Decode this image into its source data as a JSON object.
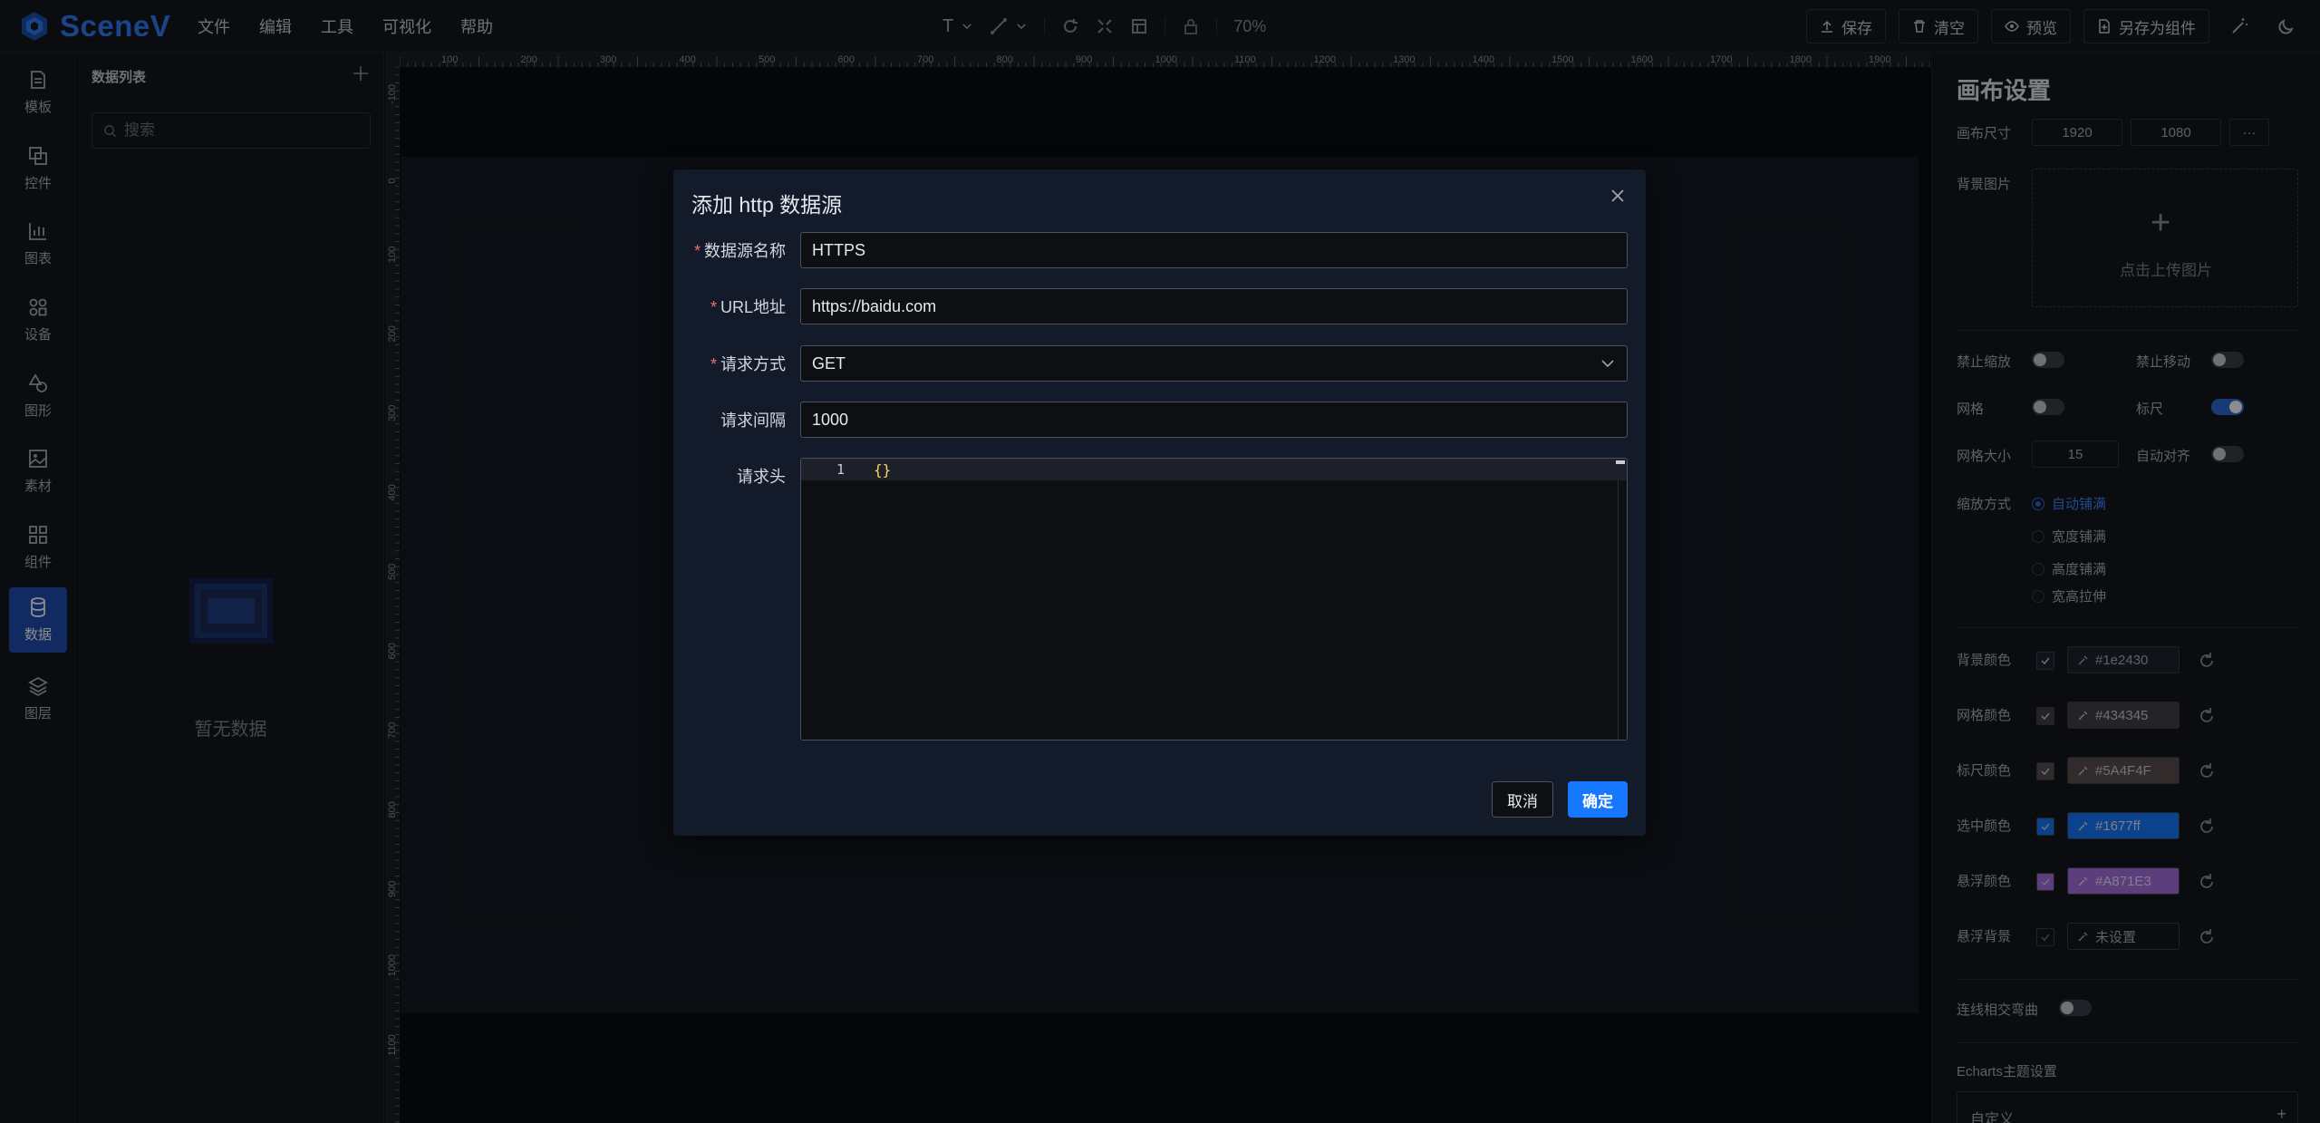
{
  "app": {
    "name": "SceneV"
  },
  "menu": [
    "文件",
    "编辑",
    "工具",
    "可视化",
    "帮助"
  ],
  "toolbar": {
    "zoom": "70%",
    "text_tool": "T"
  },
  "actions": {
    "save": "保存",
    "clear": "清空",
    "preview": "预览",
    "save_as_component": "另存为组件"
  },
  "leftnav": [
    {
      "label": "模板",
      "icon": "template-icon"
    },
    {
      "label": "控件",
      "icon": "widget-icon"
    },
    {
      "label": "图表",
      "icon": "chart-icon"
    },
    {
      "label": "设备",
      "icon": "device-icon"
    },
    {
      "label": "图形",
      "icon": "shape-icon"
    },
    {
      "label": "素材",
      "icon": "image-icon"
    },
    {
      "label": "组件",
      "icon": "component-icon"
    },
    {
      "label": "数据",
      "icon": "database-icon"
    },
    {
      "label": "图层",
      "icon": "layers-icon"
    }
  ],
  "datapanel": {
    "title": "数据列表",
    "search_placeholder": "搜索",
    "empty_text": "暂无数据"
  },
  "rulers": {
    "top": [
      "100",
      "200",
      "300",
      "400",
      "500",
      "600",
      "700",
      "800",
      "900",
      "1000",
      "1100",
      "1200",
      "1300",
      "1400",
      "1500",
      "1600",
      "1700",
      "1800",
      "1900"
    ],
    "left": [
      "-100",
      "0",
      "100",
      "200",
      "300",
      "400",
      "500",
      "600",
      "700",
      "800",
      "900",
      "1000",
      "1100"
    ]
  },
  "dialog": {
    "title": "添加 http 数据源",
    "fields": {
      "name_label": "数据源名称",
      "name_value": "HTTPS",
      "url_label": "URL地址",
      "url_value": "https://baidu.com",
      "method_label": "请求方式",
      "method_value": "GET",
      "interval_label": "请求间隔",
      "interval_value": "1000",
      "headers_label": "请求头",
      "headers_line_no": "1",
      "headers_code": "{}"
    },
    "cancel": "取消",
    "ok": "确定"
  },
  "rightpanel": {
    "title": "画布设置",
    "canvas_size_label": "画布尺寸",
    "width": "1920",
    "height": "1080",
    "more": "···",
    "bg_image_label": "背景图片",
    "upload_plus": "+",
    "upload_text": "点击上传图片",
    "disable_zoom": "禁止缩放",
    "disable_move": "禁止移动",
    "grid": "网格",
    "ruler": "标尺",
    "grid_size_label": "网格大小",
    "grid_size": "15",
    "auto_align": "自动对齐",
    "scale_mode_label": "缩放方式",
    "scale_modes": [
      "自动铺满",
      "宽度铺满",
      "高度铺满",
      "宽高拉伸"
    ],
    "colors": [
      {
        "label": "背景颜色",
        "value": "#1e2430",
        "swatch": "#1e2430",
        "text": "#aab0b9"
      },
      {
        "label": "网格颜色",
        "value": "#434345",
        "swatch": "#434345",
        "text": "#c9ced6"
      },
      {
        "label": "标尺颜色",
        "value": "#5A4F4F",
        "swatch": "#5A4F4F",
        "text": "#c9ced6"
      },
      {
        "label": "选中颜色",
        "value": "#1677ff",
        "swatch": "#1677ff",
        "text": "#dfe9ff"
      },
      {
        "label": "悬浮颜色",
        "value": "#A871E3",
        "swatch": "#A871E3",
        "text": "#efe4fb"
      },
      {
        "label": "悬浮背景",
        "value": "未设置",
        "swatch": "#14171d",
        "text": "#aab0b9"
      }
    ],
    "line_cross_label": "连线相交弯曲",
    "echarts_title": "Echarts主题设置",
    "echarts_select": "自定义"
  }
}
